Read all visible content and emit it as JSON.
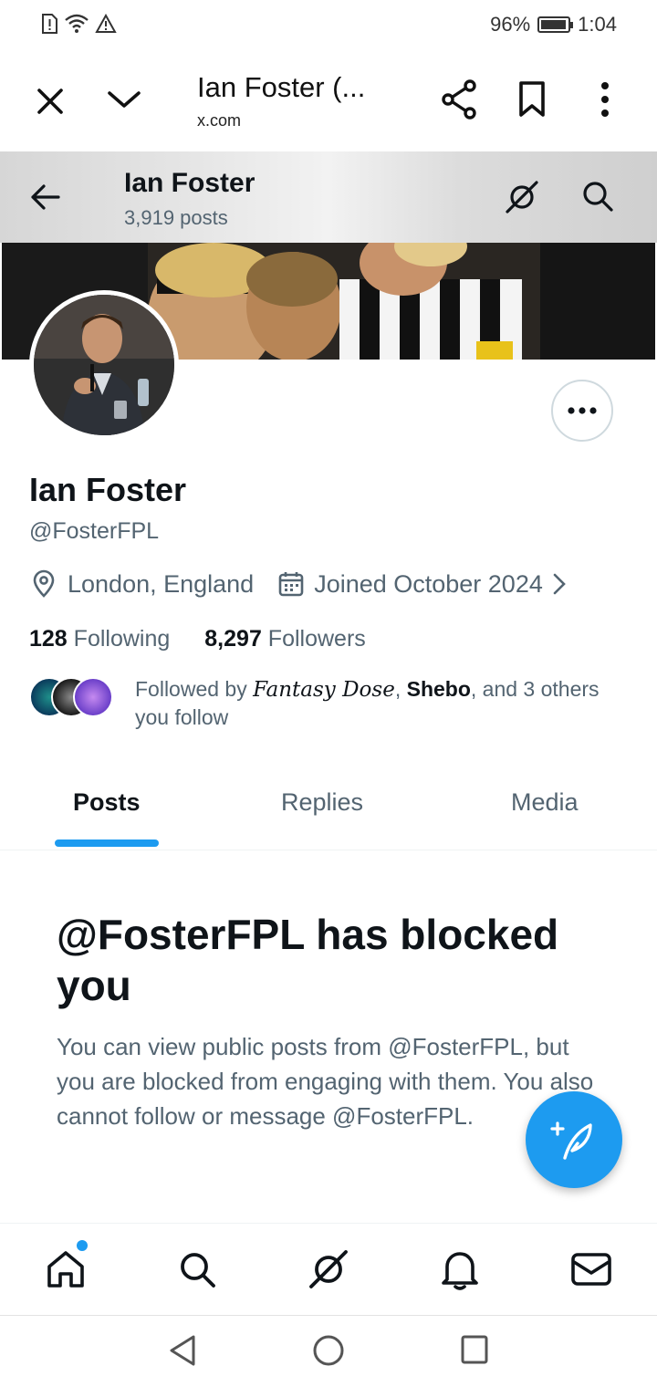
{
  "status_bar": {
    "battery": "96%",
    "time": "1:04",
    "battery_level": 0.96
  },
  "browser": {
    "title": "Ian Foster (...",
    "url": "x.com"
  },
  "profile_header": {
    "name": "Ian Foster",
    "posts_count": "3,919 posts"
  },
  "profile": {
    "display_name": "Ian Foster",
    "handle": "@FosterFPL",
    "location": "London, England",
    "joined": "Joined October 2024",
    "following_count": "128",
    "following_label": "Following",
    "followers_count": "8,297",
    "followers_label": "Followers",
    "followed_by": {
      "prefix": "Followed by",
      "name1": "Fantasy Dose",
      "sep1": ",",
      "name2": "Shebo",
      "suffix": ", and 3 others you follow"
    }
  },
  "tabs": [
    {
      "label": "Posts",
      "active": true
    },
    {
      "label": "Replies",
      "active": false
    },
    {
      "label": "Media",
      "active": false
    }
  ],
  "blocked": {
    "title": "@FosterFPL has blocked you",
    "body": "You can view public posts from @FosterFPL, but you are blocked from engaging with them. You also cannot follow or message @FosterFPL."
  },
  "colors": {
    "accent": "#1d9bf0",
    "text_primary": "#0f1419",
    "text_secondary": "#536471"
  },
  "icons": {
    "close": "close-icon",
    "collapse": "chevron-down-icon",
    "share": "share-icon",
    "bookmark": "bookmark-icon",
    "menu": "more-vertical-icon",
    "back": "back-arrow-icon",
    "grok": "grok-icon",
    "search": "search-icon",
    "location": "location-pin-icon",
    "calendar": "calendar-icon",
    "compose": "compose-icon",
    "home": "home-icon",
    "notifications": "bell-icon",
    "messages": "mail-icon"
  }
}
